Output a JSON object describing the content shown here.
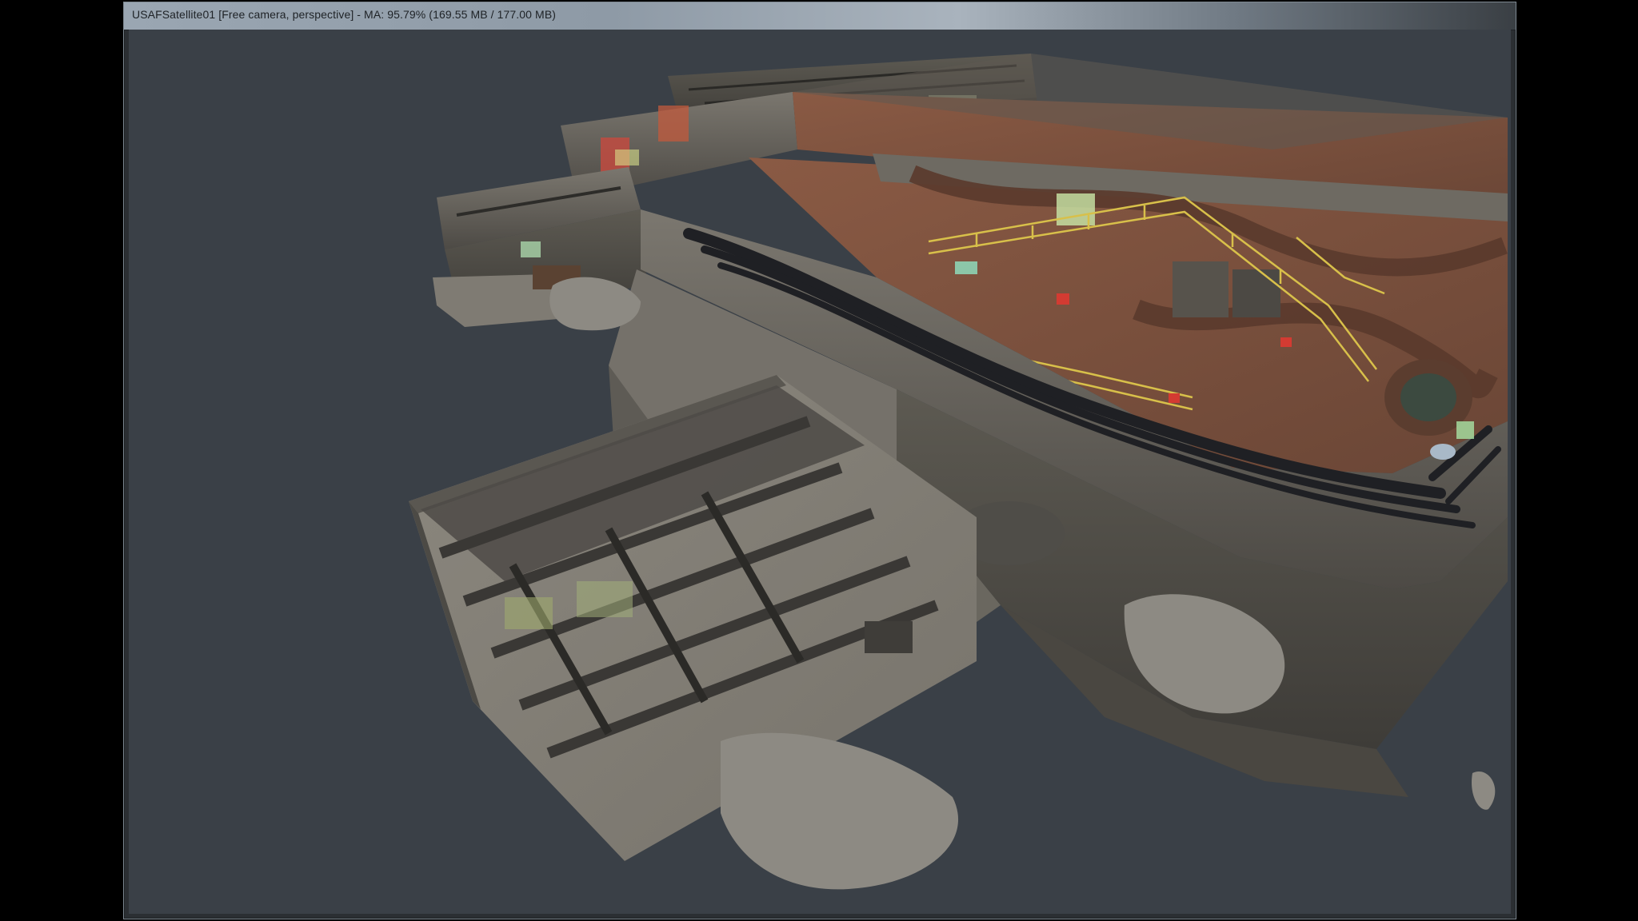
{
  "window": {
    "title": "USAFSatellite01 [Free camera, perspective] - MA: 95.79% (169.55 MB / 177.00 MB)"
  },
  "viewport": {
    "background_color": "#3a4047",
    "content": "3d-level-model-perspective"
  },
  "colors": {
    "titlebar": "#9aa6b2",
    "wall": "#6f6a62",
    "rust": "#7a4f3c",
    "floor": "#8a857c",
    "railing": "#d8c04a",
    "pipe": "#1e1f22"
  }
}
